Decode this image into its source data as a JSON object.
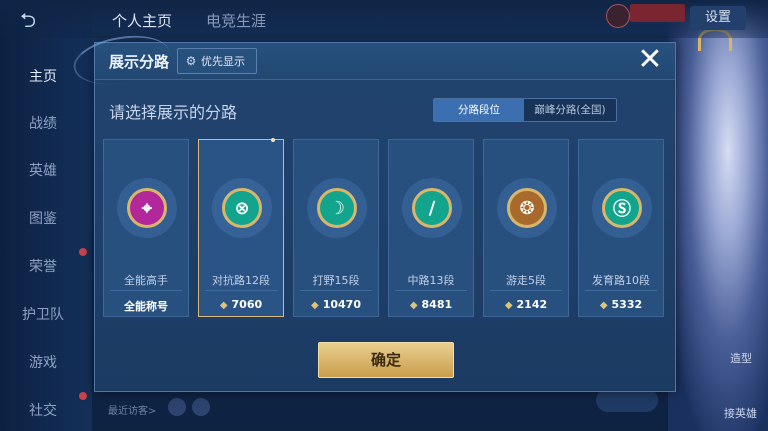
{
  "top": {
    "tabs": [
      {
        "label": "个人主页"
      },
      {
        "label": "电竞生涯"
      }
    ],
    "settings_label": "设置"
  },
  "sidebar": {
    "items": [
      {
        "label": "主页",
        "active": true
      },
      {
        "label": "战绩"
      },
      {
        "label": "英雄"
      },
      {
        "label": "图鉴"
      },
      {
        "label": "荣誉"
      },
      {
        "label": "护卫队"
      },
      {
        "label": "游戏"
      },
      {
        "label": "社交"
      }
    ]
  },
  "footer": {
    "recent_visitors": "最近访客>"
  },
  "right_panel": {
    "labels": [
      "造型",
      "接英雄"
    ]
  },
  "dialog": {
    "title": "展示分路",
    "priority_label": "优先显示",
    "subtitle": "请选择展示的分路",
    "toggle": {
      "options": [
        "分路段位",
        "巅峰分路(全国)"
      ],
      "selected": "分路段位"
    },
    "cards": [
      {
        "label": "全能高手",
        "value": "全能称号",
        "icon": "all-round-badge-icon",
        "color": "#b2289a"
      },
      {
        "label": "对抗路12段",
        "value": "7060",
        "icon": "clash-lane-badge-icon",
        "color": "#13a48e",
        "selected": true
      },
      {
        "label": "打野15段",
        "value": "10470",
        "icon": "jungle-badge-icon",
        "color": "#13a48e"
      },
      {
        "label": "中路13段",
        "value": "8481",
        "icon": "mid-lane-badge-icon",
        "color": "#13a48e"
      },
      {
        "label": "游走5段",
        "value": "2142",
        "icon": "roam-badge-icon",
        "color": "#a86a2c"
      },
      {
        "label": "发育路10段",
        "value": "5332",
        "icon": "farm-lane-badge-icon",
        "color": "#13a48e"
      }
    ],
    "confirm_label": "确定"
  }
}
